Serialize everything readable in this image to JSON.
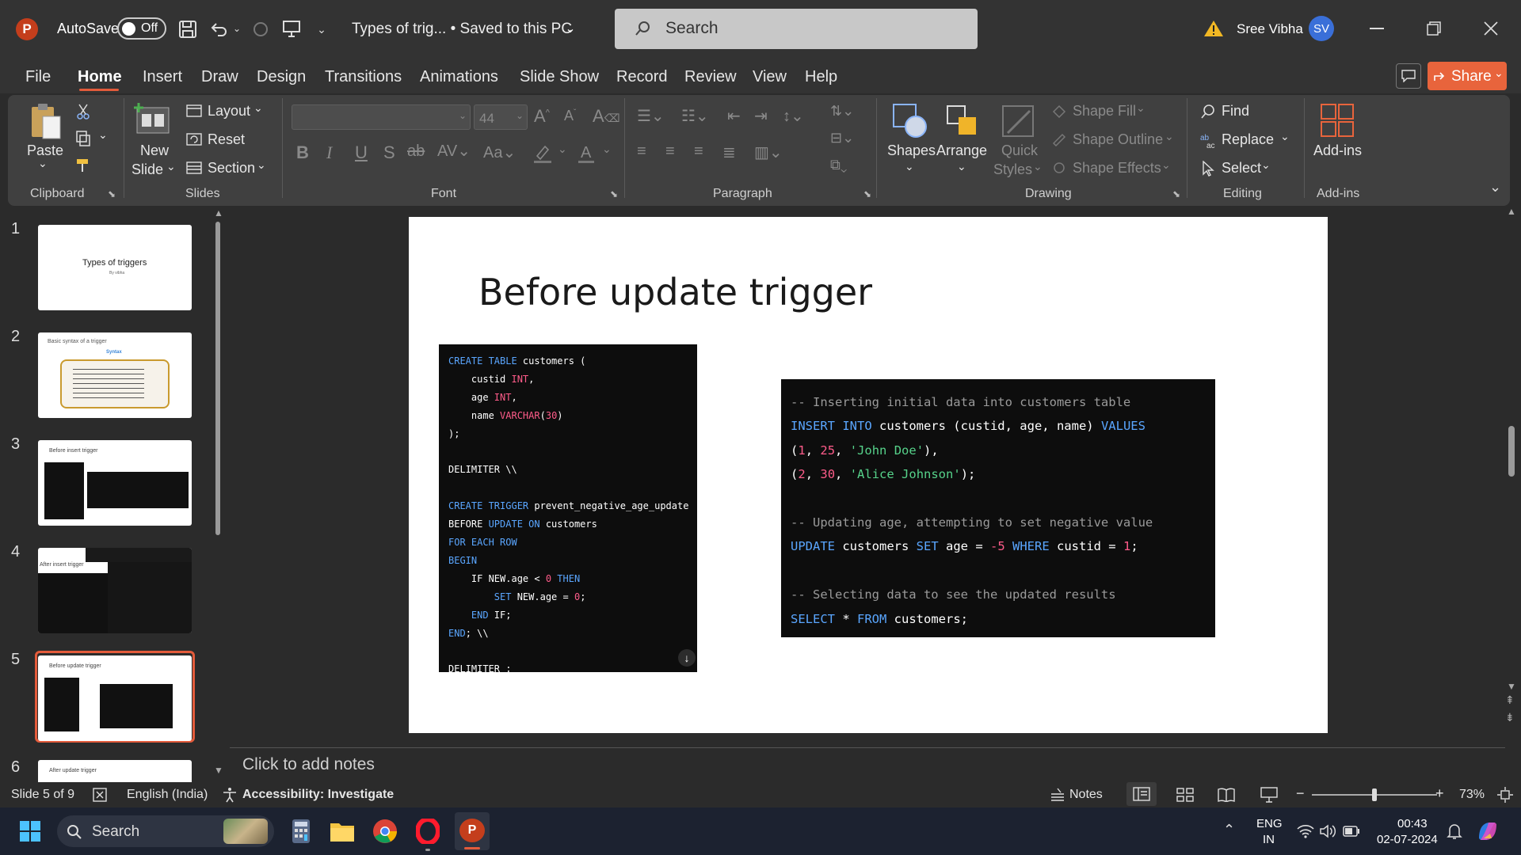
{
  "titlebar": {
    "autosave_label": "AutoSave",
    "autosave_state": "Off",
    "doc_title": "Types of trig... • Saved to this PC",
    "search_placeholder": "Search",
    "user_name": "Sree Vibha",
    "user_initials": "SV"
  },
  "tabs": [
    "File",
    "Home",
    "Insert",
    "Draw",
    "Design",
    "Transitions",
    "Animations",
    "Slide Show",
    "Record",
    "Review",
    "View",
    "Help"
  ],
  "share_label": "Share",
  "ribbon": {
    "clipboard": {
      "paste": "Paste",
      "group": "Clipboard"
    },
    "slides": {
      "new_slide_1": "New",
      "new_slide_2": "Slide",
      "layout": "Layout",
      "reset": "Reset",
      "section": "Section",
      "group": "Slides"
    },
    "font": {
      "size": "44",
      "group": "Font"
    },
    "paragraph": {
      "group": "Paragraph"
    },
    "drawing": {
      "shapes": "Shapes",
      "arrange": "Arrange",
      "quick_1": "Quick",
      "quick_2": "Styles",
      "shape_fill": "Shape Fill",
      "shape_outline": "Shape Outline",
      "shape_effects": "Shape Effects",
      "group": "Drawing"
    },
    "editing": {
      "find": "Find",
      "replace": "Replace",
      "select": "Select",
      "group": "Editing"
    },
    "addins": {
      "label": "Add-ins",
      "group": "Add-ins"
    }
  },
  "thumbnails": [
    {
      "num": "1",
      "title": "Types of triggers",
      "sub": "By vibha"
    },
    {
      "num": "2",
      "title": "Basic syntax of a trigger",
      "sub": "Syntax"
    },
    {
      "num": "3",
      "title": "Before insert trigger",
      "sub": ""
    },
    {
      "num": "4",
      "title": "After insert trigger",
      "sub": ""
    },
    {
      "num": "5",
      "title": "Before update trigger",
      "sub": ""
    },
    {
      "num": "6",
      "title": "After update trigger",
      "sub": ""
    }
  ],
  "slide": {
    "title": "Before update trigger",
    "code1": [
      [
        [
          "k",
          "CREATE TABLE"
        ],
        [
          "w",
          " customers ("
        ]
      ],
      [
        [
          "w",
          "    custid "
        ],
        [
          "n",
          "INT"
        ],
        [
          "w",
          ","
        ]
      ],
      [
        [
          "w",
          "    age "
        ],
        [
          "n",
          "INT"
        ],
        [
          "w",
          ","
        ]
      ],
      [
        [
          "w",
          "    name "
        ],
        [
          "n",
          "VARCHAR"
        ],
        [
          "w",
          "("
        ],
        [
          "n",
          "30"
        ],
        [
          "w",
          ")"
        ]
      ],
      [
        [
          "w",
          ");"
        ]
      ],
      [
        [
          "w",
          ""
        ]
      ],
      [
        [
          "w",
          "DELIMITER \\\\"
        ]
      ],
      [
        [
          "w",
          ""
        ]
      ],
      [
        [
          "k",
          "CREATE TRIGGER"
        ],
        [
          "w",
          " prevent_negative_age_update"
        ]
      ],
      [
        [
          "w",
          "BEFORE "
        ],
        [
          "k",
          "UPDATE ON"
        ],
        [
          "w",
          " customers"
        ]
      ],
      [
        [
          "k",
          "FOR EACH ROW"
        ]
      ],
      [
        [
          "k",
          "BEGIN"
        ]
      ],
      [
        [
          "w",
          "    IF NEW.age < "
        ],
        [
          "n",
          "0"
        ],
        [
          "k",
          " THEN"
        ]
      ],
      [
        [
          "k",
          "        SET"
        ],
        [
          "w",
          " NEW.age = "
        ],
        [
          "n",
          "0"
        ],
        [
          "w",
          ";"
        ]
      ],
      [
        [
          "k",
          "    END"
        ],
        [
          "w",
          " IF;"
        ]
      ],
      [
        [
          "k",
          "END"
        ],
        [
          "w",
          "; \\\\"
        ]
      ],
      [
        [
          "w",
          ""
        ]
      ],
      [
        [
          "w",
          "DELIMITER ;"
        ]
      ]
    ],
    "code2": [
      [
        [
          "c",
          "-- Inserting initial data into customers table"
        ]
      ],
      [
        [
          "k",
          "INSERT INTO"
        ],
        [
          "w",
          " customers (custid, age, name) "
        ],
        [
          "k",
          "VALUES"
        ]
      ],
      [
        [
          "w",
          "("
        ],
        [
          "n",
          "1"
        ],
        [
          "w",
          ", "
        ],
        [
          "n",
          "25"
        ],
        [
          "w",
          ", "
        ],
        [
          "s",
          "'John Doe'"
        ],
        [
          "w",
          "),"
        ]
      ],
      [
        [
          "w",
          "("
        ],
        [
          "n",
          "2"
        ],
        [
          "w",
          ", "
        ],
        [
          "n",
          "30"
        ],
        [
          "w",
          ", "
        ],
        [
          "s",
          "'Alice Johnson'"
        ],
        [
          "w",
          ");"
        ]
      ],
      [
        [
          "w",
          ""
        ]
      ],
      [
        [
          "c",
          "-- Updating age, attempting to set negative value"
        ]
      ],
      [
        [
          "k",
          "UPDATE"
        ],
        [
          "w",
          " customers "
        ],
        [
          "k",
          "SET"
        ],
        [
          "w",
          " age = "
        ],
        [
          "n",
          "-5"
        ],
        [
          "k",
          " WHERE"
        ],
        [
          "w",
          " custid = "
        ],
        [
          "n",
          "1"
        ],
        [
          "w",
          ";"
        ]
      ],
      [
        [
          "w",
          ""
        ]
      ],
      [
        [
          "c",
          "-- Selecting data to see the updated results"
        ]
      ],
      [
        [
          "k",
          "SELECT"
        ],
        [
          "w",
          " * "
        ],
        [
          "k",
          "FROM"
        ],
        [
          "w",
          " customers;"
        ]
      ]
    ]
  },
  "notes_placeholder": "Click to add notes",
  "status": {
    "slide_info": "Slide 5 of 9",
    "language": "English (India)",
    "accessibility": "Accessibility: Investigate",
    "notes": "Notes",
    "zoom": "73%",
    "zoom_level": 0.5
  },
  "taskbar": {
    "search": "Search",
    "lang_1": "ENG",
    "lang_2": "IN",
    "time": "00:43",
    "date": "02-07-2024"
  }
}
